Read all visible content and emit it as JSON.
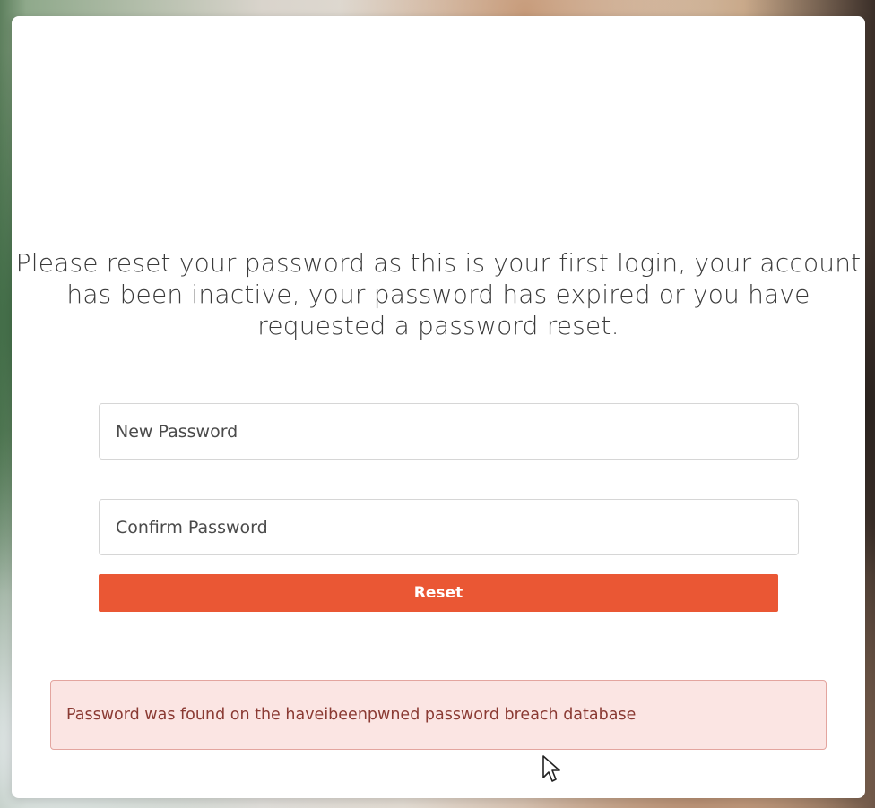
{
  "reset_form": {
    "message": "Please reset your password as this is your first login, your account has been inactive, your password has expired or you have requested a password reset.",
    "new_password": {
      "placeholder": "New Password",
      "value": ""
    },
    "confirm_password": {
      "placeholder": "Confirm Password",
      "value": ""
    },
    "reset_button_label": "Reset"
  },
  "alert": {
    "text": "Password was found on the haveibeenpwned password breach database"
  },
  "colors": {
    "accent": "#ea5734",
    "alert_background": "#fbe5e3",
    "alert_border": "#e3a59f",
    "alert_text": "#8a3a33"
  },
  "icons": {
    "cursor": "mouse-pointer-icon"
  }
}
